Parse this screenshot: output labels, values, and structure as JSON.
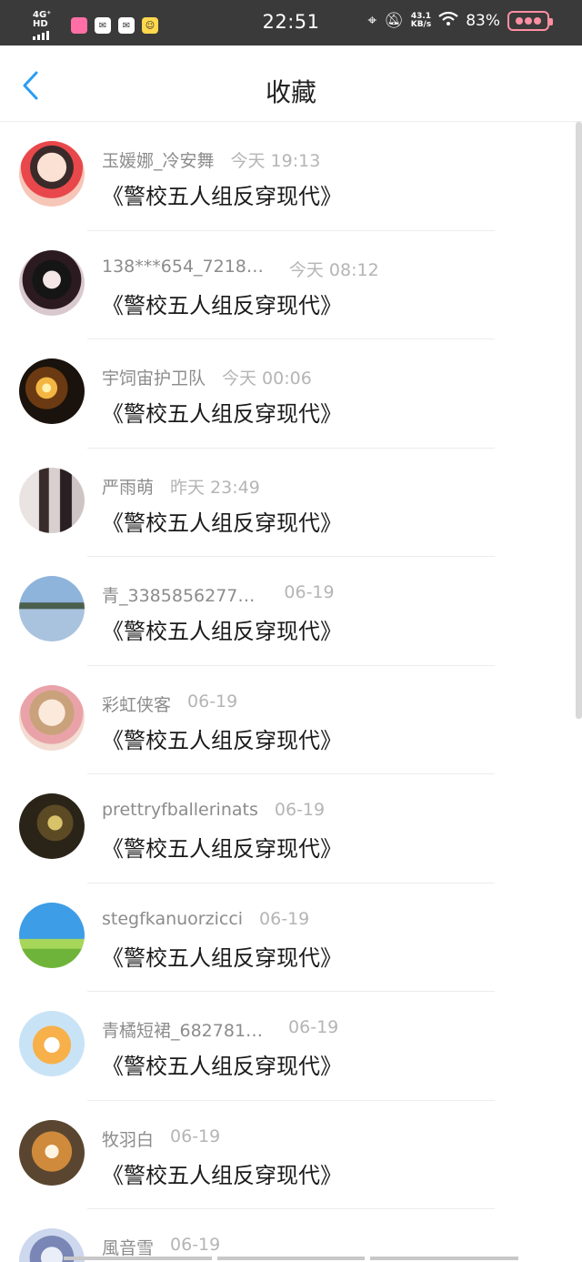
{
  "status_bar": {
    "network": "4G⁺ HD",
    "time": "22:51",
    "net_speed_value": "43.1",
    "net_speed_unit": "KB/s",
    "battery": "83%"
  },
  "header": {
    "title": "收藏",
    "back_icon": "chevron-left-icon"
  },
  "items": [
    {
      "user": "玉媛娜_冷安舞",
      "time": "今天 19:13",
      "book": "《警校五人组反穿现代》"
    },
    {
      "user": "138***654_7218…",
      "time": "今天 08:12",
      "book": "《警校五人组反穿现代》"
    },
    {
      "user": "宇饲宙护卫队",
      "time": "今天 00:06",
      "book": "《警校五人组反穿现代》"
    },
    {
      "user": "严雨萌",
      "time": "昨天 23:49",
      "book": "《警校五人组反穿现代》"
    },
    {
      "user": "青_3385856277…",
      "time": "06-19",
      "book": "《警校五人组反穿现代》"
    },
    {
      "user": "彩虹侠客",
      "time": "06-19",
      "book": "《警校五人组反穿现代》"
    },
    {
      "user": "prettryfballerinats",
      "time": "06-19",
      "book": "《警校五人组反穿现代》"
    },
    {
      "user": "stegfkanuorzicci",
      "time": "06-19",
      "book": "《警校五人组反穿现代》"
    },
    {
      "user": "青橘短裙_682781…",
      "time": "06-19",
      "book": "《警校五人组反穿现代》"
    },
    {
      "user": "牧羽白",
      "time": "06-19",
      "book": "《警校五人组反穿现代》"
    },
    {
      "user": "風音雪",
      "time": "06-19",
      "book": ""
    }
  ],
  "colors": {
    "accent": "#2a9df4",
    "status_bar_bg": "#3a3a3a"
  }
}
